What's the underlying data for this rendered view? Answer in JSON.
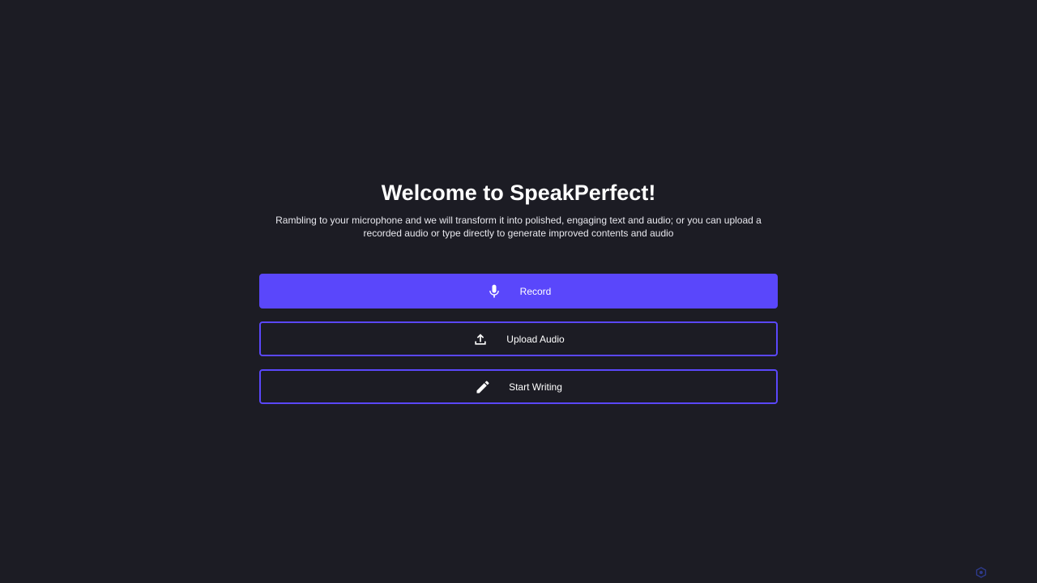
{
  "header": {
    "title": "Welcome to SpeakPerfect!",
    "subtitle": "Rambling to your microphone and we will transform it into polished, engaging text and audio; or you can upload a recorded audio or type directly to generate improved contents and audio"
  },
  "actions": {
    "record_label": "Record",
    "upload_label": "Upload Audio",
    "write_label": "Start Writing"
  },
  "icons": {
    "record": "microphone-icon",
    "upload": "upload-icon",
    "write": "pencil-icon",
    "corner": "corner-logo-icon"
  },
  "colors": {
    "background": "#1c1c24",
    "accent": "#5a47fb",
    "text": "#ffffff"
  }
}
